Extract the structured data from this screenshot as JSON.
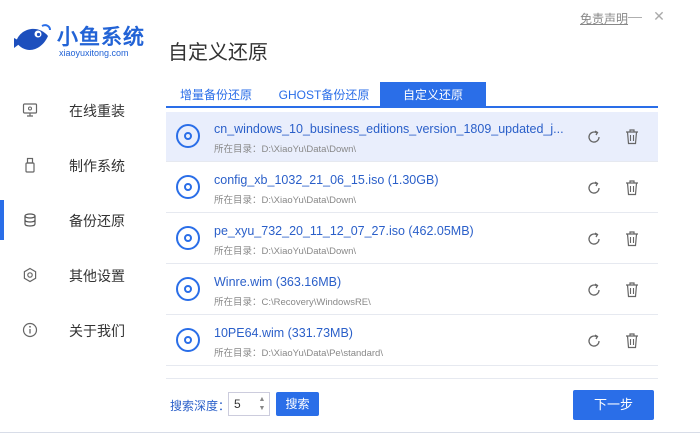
{
  "header": {
    "logo_name": "小鱼系统",
    "logo_url": "xiaoyuxitong.com",
    "page_title": "自定义还原",
    "disclaimer": "免责声明",
    "min_glyph": "—",
    "close_glyph": "✕"
  },
  "sidebar": {
    "items": [
      {
        "label": "在线重装",
        "icon": "monitor-icon"
      },
      {
        "label": "制作系统",
        "icon": "usb-icon"
      },
      {
        "label": "备份还原",
        "icon": "backup-icon"
      },
      {
        "label": "其他设置",
        "icon": "settings-icon"
      },
      {
        "label": "关于我们",
        "icon": "info-icon"
      }
    ],
    "active_index": 2
  },
  "tabs": [
    {
      "label": "增量备份还原"
    },
    {
      "label": "GHOST备份还原"
    },
    {
      "label": "自定义还原"
    }
  ],
  "active_tab": 2,
  "files": [
    {
      "name": "cn_windows_10_business_editions_version_1809_updated_j...",
      "path": "所在目录：D:\\XiaoYu\\Data\\Down\\"
    },
    {
      "name": "config_xb_1032_21_06_15.iso (1.30GB)",
      "path": "所在目录：D:\\XiaoYu\\Data\\Down\\"
    },
    {
      "name": "pe_xyu_732_20_11_12_07_27.iso (462.05MB)",
      "path": "所在目录：D:\\XiaoYu\\Data\\Down\\"
    },
    {
      "name": "Winre.wim (363.16MB)",
      "path": "所在目录：C:\\Recovery\\WindowsRE\\"
    },
    {
      "name": "10PE64.wim (331.73MB)",
      "path": "所在目录：D:\\XiaoYu\\Data\\Pe\\standard\\"
    }
  ],
  "selected_row": 0,
  "bottom": {
    "depth_label": "搜索深度：",
    "depth_value": "5",
    "stepper_up": "▲",
    "stepper_down": "▼",
    "search_label": "搜索",
    "next_label": "下一步"
  },
  "colors": {
    "accent": "#2a6ee8",
    "brand": "#2263d6",
    "selected_row": "#e9eefc"
  }
}
